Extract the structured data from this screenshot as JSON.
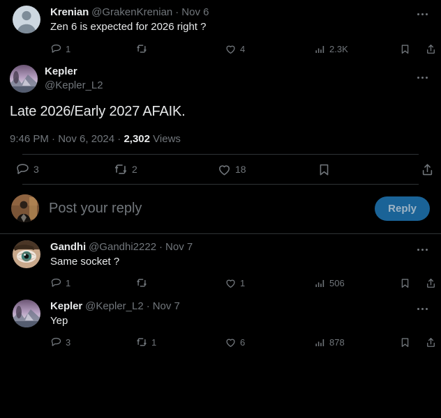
{
  "theme": {
    "background": "#000000",
    "text_primary": "#e7e9ea",
    "text_secondary": "#71767b",
    "divider": "#2f3336",
    "accent_button_bg": "#1a6397",
    "accent_button_text": "#9fb4c4",
    "thread_line": "#333639"
  },
  "parent_tweet": {
    "author": {
      "display_name": "Krenian",
      "handle": "@GrakenKrenian",
      "avatar_type": "default-person-avatar"
    },
    "separator": "·",
    "date": "Nov 6",
    "text": "Zen 6 is expected for 2026 right ?",
    "actions": {
      "reply_count": "1",
      "retweet_count": "",
      "like_count": "4",
      "views_count": "2.3K",
      "bookmark_label": "",
      "share_label": ""
    },
    "more_menu_label": "More"
  },
  "focused_tweet": {
    "author": {
      "display_name": "Kepler",
      "handle": "@Kepler_L2",
      "avatar_type": "purple-landscape-avatar"
    },
    "text": "Late 2026/Early 2027 AFAIK.",
    "meta": {
      "time": "9:46 PM",
      "sep1": "·",
      "date": "Nov 6, 2024",
      "sep2": "·",
      "views_number": "2,302",
      "views_label": "Views"
    },
    "actions": {
      "reply_count": "3",
      "retweet_count": "2",
      "like_count": "18",
      "bookmark_label": "",
      "share_label": ""
    },
    "more_menu_label": "More"
  },
  "composer": {
    "avatar_type": "person-dark-suit-avatar",
    "placeholder": "Post your reply",
    "reply_button_label": "Reply"
  },
  "replies": [
    {
      "author": {
        "display_name": "Gandhi",
        "handle": "@Gandhi2222",
        "avatar_type": "eye-closeup-avatar"
      },
      "separator": "·",
      "date": "Nov 7",
      "text": "Same socket ?",
      "actions": {
        "reply_count": "1",
        "retweet_count": "",
        "like_count": "1",
        "views_count": "506",
        "bookmark_label": "",
        "share_label": ""
      },
      "more_menu_label": "More"
    },
    {
      "author": {
        "display_name": "Kepler",
        "handle": "@Kepler_L2",
        "avatar_type": "purple-landscape-avatar"
      },
      "separator": "·",
      "date": "Nov 7",
      "text": "Yep",
      "actions": {
        "reply_count": "3",
        "retweet_count": "1",
        "like_count": "6",
        "views_count": "878",
        "bookmark_label": "",
        "share_label": ""
      },
      "more_menu_label": "More"
    }
  ],
  "icons": {
    "reply": "comment-icon",
    "retweet": "retweet-icon",
    "like": "heart-icon",
    "views": "analytics-bar-icon",
    "bookmark": "bookmark-icon",
    "share": "share-upload-icon",
    "more": "more-horizontal-icon"
  }
}
